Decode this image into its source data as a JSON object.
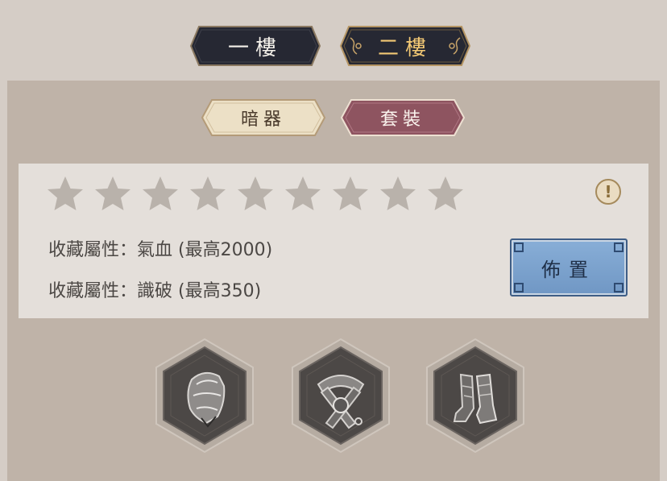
{
  "floors": [
    {
      "label": "一樓",
      "selected": false
    },
    {
      "label": "二樓",
      "selected": true
    }
  ],
  "categories": [
    {
      "label": "暗器",
      "selected": false
    },
    {
      "label": "套裝",
      "selected": true
    }
  ],
  "collection": {
    "star_count": 9,
    "attributes": [
      "收藏屬性：氣血 (最高2000)",
      "收藏屬性：識破 (最高350)"
    ],
    "info_icon": "!",
    "place_button_label": "佈置"
  },
  "gear_slots": [
    {
      "icon": "helmet-icon"
    },
    {
      "icon": "belt-icon"
    },
    {
      "icon": "boots-icon"
    }
  ],
  "colors": {
    "floor_tab_bg": "#262833",
    "selected_floor_text": "#f2c874",
    "category_selected": "#8e5460",
    "category_unselected": "#ece0c6",
    "place_button": "#7aa2cf",
    "star": "#b9b2ab"
  }
}
